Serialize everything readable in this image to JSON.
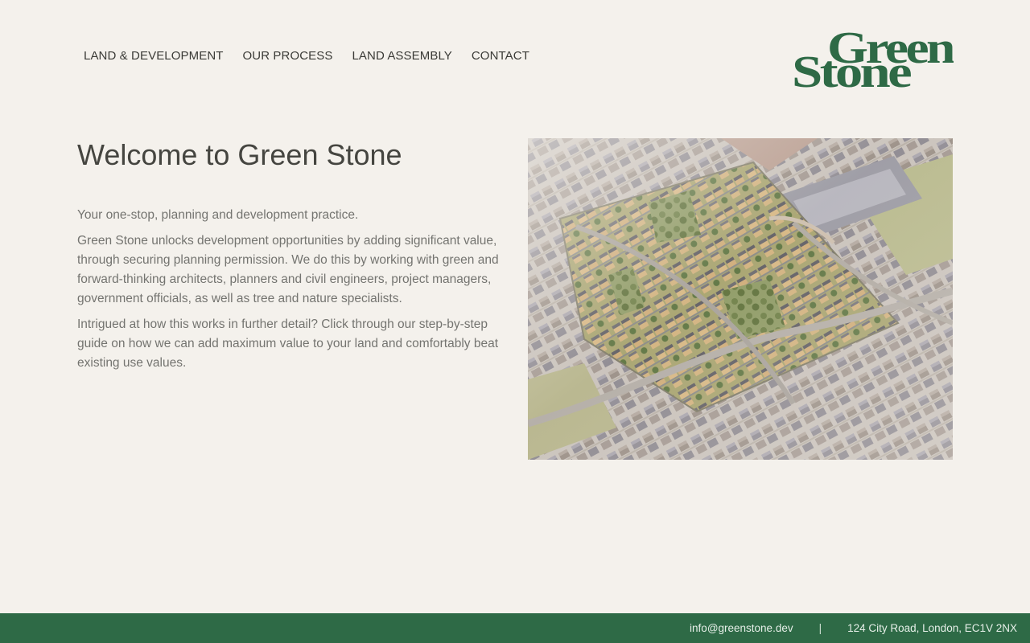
{
  "nav": {
    "items": [
      {
        "label": "LAND & DEVELOPMENT"
      },
      {
        "label": "OUR PROCESS"
      },
      {
        "label": "LAND ASSEMBLY"
      },
      {
        "label": "CONTACT"
      }
    ]
  },
  "logo": {
    "line1": "Green",
    "line2": "Stone",
    "color": "#2e6a46"
  },
  "intro": {
    "heading": "Welcome to Green Stone",
    "tagline": "Your one-stop, planning and development practice.",
    "paragraph1": "Green Stone unlocks development opportunities by adding significant value, through securing planning permission. We do this by working with green and forward-thinking architects, planners and civil engineers, project managers, government officials, as well as tree and nature specialists.",
    "paragraph2": "Intrigued at how this works in further detail? Click through our step-by-step guide on how we can add maximum value to your land and comfortably beat existing use values."
  },
  "hero_image": {
    "subject": "aerial view of housing development"
  },
  "footer": {
    "email": "info@greenstone.dev",
    "separator": "|",
    "address": "124 City Road, London, EC1V 2NX"
  },
  "colors": {
    "background": "#f4f1ec",
    "brand_green": "#2e6a46",
    "text_dark": "#454540",
    "text_body": "#747470"
  }
}
